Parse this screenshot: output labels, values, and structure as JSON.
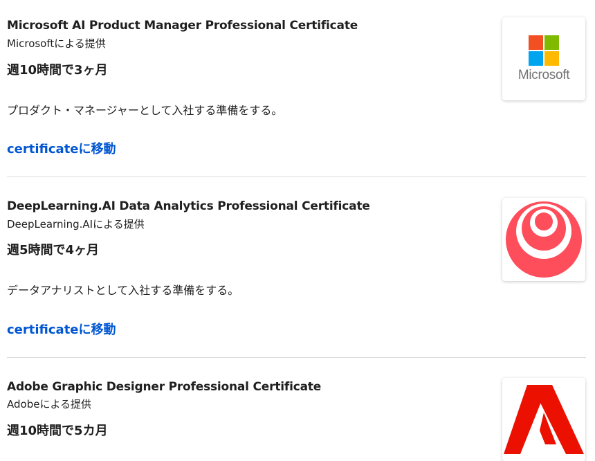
{
  "courses": [
    {
      "title": "Microsoft AI Product Manager Professional Certificate",
      "provider": "Microsoftによる提供",
      "duration": "週10時間で3ヶ月",
      "description": "プロダクト・マネージャーとして入社する準備をする。",
      "link": "certificateに移動",
      "logo_text": "Microsoft",
      "logo_colors": [
        "#f25022",
        "#7fba00",
        "#00a4ef",
        "#ffb900"
      ]
    },
    {
      "title": "DeepLearning.AI Data Analytics Professional Certificate",
      "provider": "DeepLearning.AIによる提供",
      "duration": "週5時間で4ヶ月",
      "description": "データアナリストとして入社する準備をする。",
      "link": "certificateに移動",
      "logo_color": "#ff4e5b"
    },
    {
      "title": "Adobe Graphic Designer Professional Certificate",
      "provider": "Adobeによる提供",
      "duration": "週10時間で5カ月",
      "logo_color": "#eb1000"
    }
  ]
}
